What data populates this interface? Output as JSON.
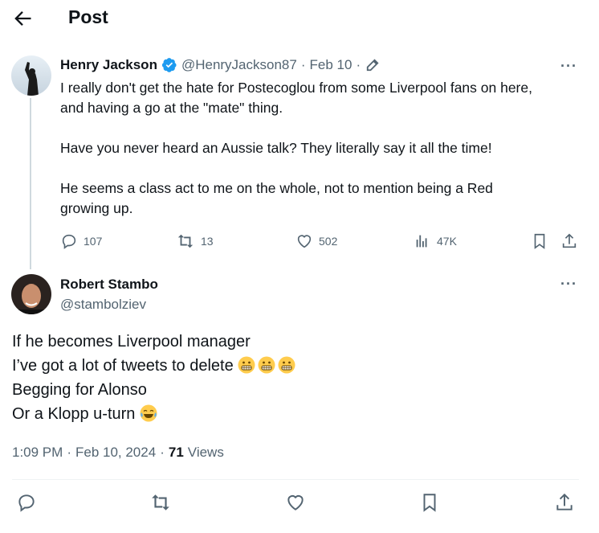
{
  "header": {
    "title": "Post"
  },
  "parent_tweet": {
    "name": "Henry Jackson",
    "handle": "@HenryJackson87",
    "separator": "·",
    "date": "Feb 10",
    "text": "I really don't get the hate for Postecoglou from some Liverpool fans on here,\nand having a go at the \"mate\" thing.\n\nHave you never heard an Aussie talk? They literally say it all the time!\n\nHe seems a class act to me on the whole, not to mention being a Red\ngrowing up.",
    "replies": "107",
    "retweets": "13",
    "likes": "502",
    "views": "47K",
    "more": "···"
  },
  "main_tweet": {
    "name": "Robert Stambo",
    "handle": "@stambolziev",
    "more": "···",
    "line1": "If he becomes Liverpool manager",
    "line2": "I’ve got a lot of tweets to delete",
    "line3": "Begging for Alonso",
    "line4": "Or a Klopp u-turn",
    "time": "1:09 PM",
    "sep": "·",
    "date": "Feb 10, 2024",
    "sep2": "·",
    "views_count": "71",
    "views_label": "Views"
  },
  "icons": {
    "back": "arrow-left-icon",
    "verified": "verified-badge-icon",
    "edited": "pencil-icon",
    "reply": "speech-bubble-icon",
    "retweet": "retweet-icon",
    "like": "heart-icon",
    "views": "bar-chart-icon",
    "bookmark": "bookmark-icon",
    "share": "upload-icon",
    "emoji_grimace": "grimacing-face-emoji",
    "emoji_laugh": "tears-of-joy-emoji"
  },
  "colors": {
    "accent": "#1d9bf0",
    "muted": "#536471",
    "text": "#0f1419",
    "emoji": "#ffcc4d"
  }
}
